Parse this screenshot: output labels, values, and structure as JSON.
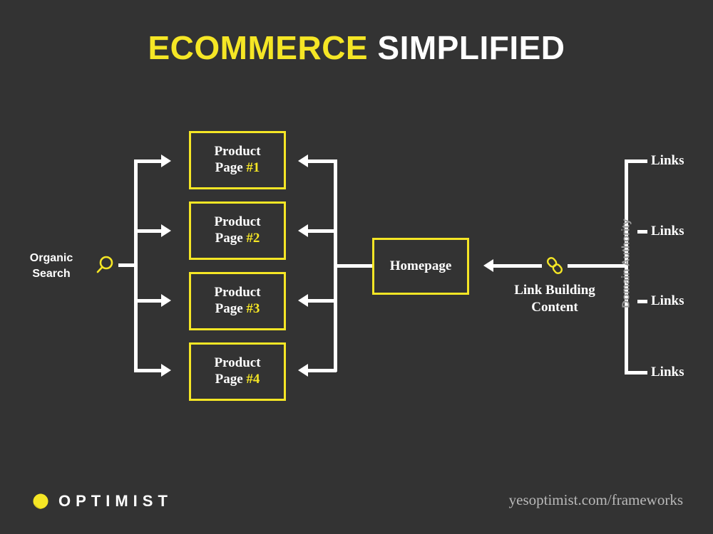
{
  "title": {
    "part_yellow": "ECOMMERCE",
    "part_white": " SIMPLIFIED"
  },
  "colors": {
    "background": "#333333",
    "accent_yellow": "#F5E625",
    "white": "#FFFFFF",
    "muted_gray": "#9a9a9a",
    "footer_gray": "#b9b9b9"
  },
  "organic_search": {
    "label_line1": "Organic",
    "label_line2": "Search",
    "icon": "magnifying-glass-icon"
  },
  "product_pages": [
    {
      "line1": "Product",
      "line2": "Page ",
      "num": "#1"
    },
    {
      "line1": "Product",
      "line2": "Page ",
      "num": "#2"
    },
    {
      "line1": "Product",
      "line2": "Page ",
      "num": "#3"
    },
    {
      "line1": "Product",
      "line2": "Page ",
      "num": "#4"
    }
  ],
  "homepage": {
    "label": "Homepage"
  },
  "link_building": {
    "line1": "Link Building",
    "line2": "Content",
    "icon": "chain-link-icon"
  },
  "domain_authority": {
    "label": "Domain Authority",
    "links": [
      {
        "label": "Links"
      },
      {
        "label": "Links"
      },
      {
        "label": "Links"
      },
      {
        "label": "Links"
      }
    ]
  },
  "footer": {
    "logo_text": "OPTIMIST",
    "logo_mark": "lemon-icon",
    "url": "yesoptimist.com/frameworks"
  }
}
